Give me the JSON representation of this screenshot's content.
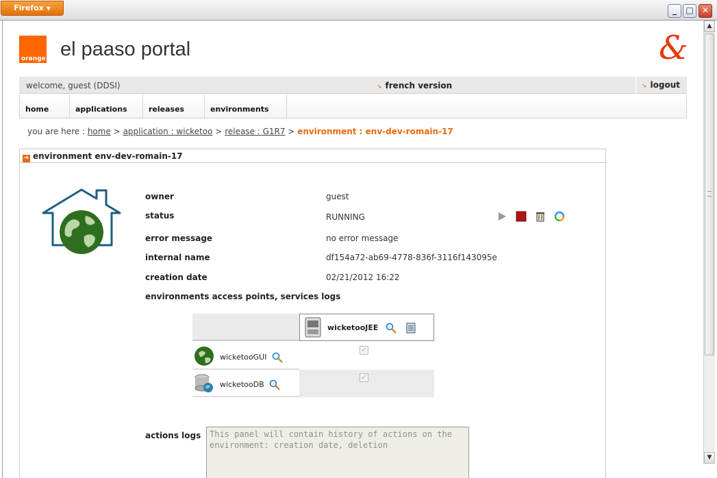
{
  "browser": {
    "app_button": "Firefox",
    "window_buttons": {
      "minimize": "_",
      "maximize": "□",
      "close": "✕"
    }
  },
  "header": {
    "logo_text": "orange",
    "site_title": "el paaso portal",
    "brand_mark": "&"
  },
  "welcome_bar": {
    "welcome": "welcome, guest (DDSI)",
    "french_version": "french version",
    "logout": "logout"
  },
  "nav": [
    "home",
    "applications",
    "releases",
    "environments"
  ],
  "breadcrumb": {
    "prefix": "you are here :",
    "links": [
      "home",
      "application : wicketoo",
      "release : G1R7"
    ],
    "separator": ">",
    "current": "environment : env-dev-romain-17"
  },
  "panel": {
    "title": "environment env-dev-romain-17",
    "fields": {
      "owner_label": "owner",
      "owner_value": "guest",
      "status_label": "status",
      "status_value": "RUNNING",
      "error_label": "error message",
      "error_value": "no error message",
      "internal_label": "internal name",
      "internal_value": "df154a72-ab69-4778-836f-3116f143095e",
      "creation_label": "creation date",
      "creation_value": "02/21/2012 16:22",
      "access_label": "environments access points, services logs"
    },
    "status_actions": [
      "play-icon",
      "stop-icon",
      "delete-icon",
      "refresh-icon"
    ],
    "access_points": {
      "column_header": "wicketooJEE",
      "rows": [
        {
          "name": "wicketooGUI",
          "checked": true
        },
        {
          "name": "wicketooDB",
          "checked": true
        }
      ]
    },
    "actions_logs": {
      "label": "actions logs",
      "content": "This panel will contain history of actions on the environment: creation date, deletion"
    }
  }
}
